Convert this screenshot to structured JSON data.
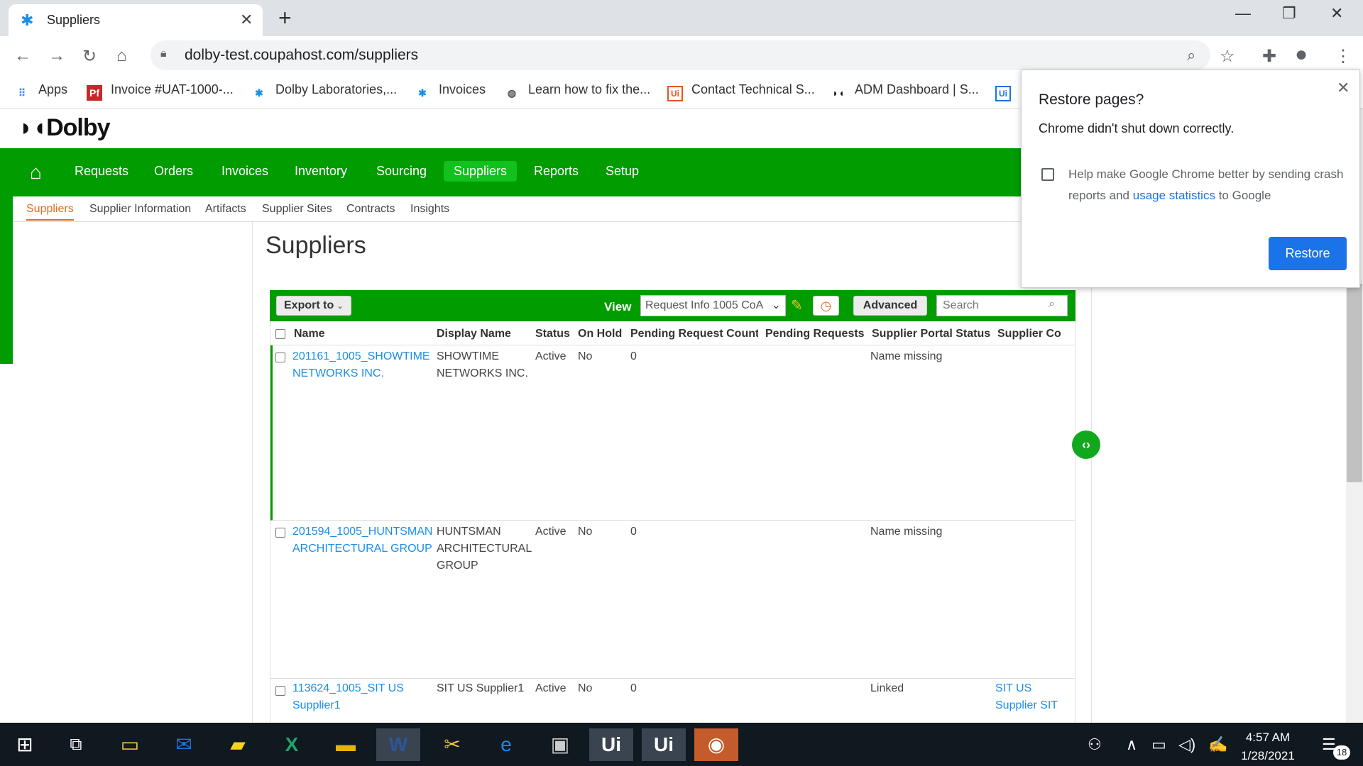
{
  "browser": {
    "tab_title": "Suppliers",
    "url": "dolby-test.coupahost.com/suppliers",
    "bookmarks": [
      {
        "label": "Apps",
        "icon": "apps-grid-icon"
      },
      {
        "label": "Invoice #UAT-1000-...",
        "icon": "pf-icon"
      },
      {
        "label": "Dolby Laboratories,...",
        "icon": "coupa-icon"
      },
      {
        "label": "Invoices",
        "icon": "coupa-icon"
      },
      {
        "label": "Learn how to fix the...",
        "icon": "globe-icon"
      },
      {
        "label": "Contact Technical S...",
        "icon": "uipath-icon"
      },
      {
        "label": "ADM Dashboard | S...",
        "icon": "dolby-icon"
      }
    ]
  },
  "app": {
    "logo": "Dolby",
    "nav": [
      "Requests",
      "Orders",
      "Invoices",
      "Inventory",
      "Sourcing",
      "Suppliers",
      "Reports",
      "Setup"
    ],
    "active_nav": "Suppliers",
    "subnav": [
      "Suppliers",
      "Supplier Information",
      "Artifacts",
      "Supplier Sites",
      "Contracts",
      "Insights"
    ],
    "page_title": "Suppliers"
  },
  "grid": {
    "export_label": "Export to",
    "view_label": "View",
    "view_value": "Request Info 1005 CoA",
    "advanced_label": "Advanced",
    "search_placeholder": "Search",
    "columns": [
      "Name",
      "Display Name",
      "Status",
      "On Hold",
      "Pending Request Count",
      "Pending Requests",
      "Supplier Portal Status",
      "Supplier Co"
    ],
    "rows": [
      {
        "name": "201161_1005_SHOWTIME NETWORKS INC.",
        "display_name": "SHOWTIME NETWORKS INC.",
        "status": "Active",
        "on_hold": "No",
        "pending_count": "0",
        "pending_requests": "",
        "portal_status": "Name missing",
        "supplier_co": ""
      },
      {
        "name": "201594_1005_HUNTSMAN ARCHITECTURAL GROUP",
        "display_name": "HUNTSMAN ARCHITECTURAL GROUP",
        "status": "Active",
        "on_hold": "No",
        "pending_count": "0",
        "pending_requests": "",
        "portal_status": "Name missing",
        "supplier_co": ""
      },
      {
        "name": "113624_1005_SIT US Supplier1",
        "display_name": "SIT US Supplier1",
        "status": "Active",
        "on_hold": "No",
        "pending_count": "0",
        "pending_requests": "",
        "portal_status": "Linked",
        "supplier_co": "SIT US Supplier SIT US Supplier"
      }
    ]
  },
  "popup": {
    "title": "Restore pages?",
    "message": "Chrome didn't shut down correctly.",
    "checkbox_text_a": "Help make Google Chrome better by sending crash reports and ",
    "checkbox_link": "usage statistics",
    "checkbox_text_b": " to Google",
    "button": "Restore"
  },
  "taskbar": {
    "time": "4:57 AM",
    "date": "1/28/2021",
    "notification_count": "18"
  },
  "colors": {
    "coupa_green": "#009c00",
    "active_nav": "#11c11d",
    "link_blue": "#1a8ee8",
    "chrome_blue": "#1a73e8"
  }
}
